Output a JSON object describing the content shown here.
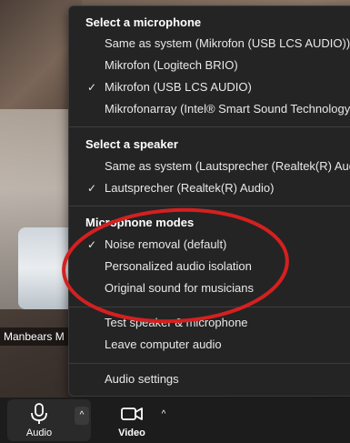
{
  "participant": {
    "name": "Manbears M"
  },
  "menu": {
    "microphone": {
      "title": "Select a microphone",
      "items": [
        {
          "label": "Same as system (Mikrofon (USB LCS AUDIO))",
          "checked": false
        },
        {
          "label": "Mikrofon (Logitech BRIO)",
          "checked": false
        },
        {
          "label": "Mikrofon (USB LCS AUDIO)",
          "checked": true
        },
        {
          "label": "Mikrofonarray (Intel® Smart Sound Technology",
          "checked": false
        }
      ]
    },
    "speaker": {
      "title": "Select a speaker",
      "items": [
        {
          "label": "Same as system (Lautsprecher (Realtek(R) Audio",
          "checked": false
        },
        {
          "label": "Lautsprecher (Realtek(R) Audio)",
          "checked": true
        }
      ]
    },
    "modes": {
      "title": "Microphone modes",
      "items": [
        {
          "label": "Noise removal (default)",
          "checked": true
        },
        {
          "label": "Personalized audio isolation",
          "checked": false
        },
        {
          "label": "Original sound for musicians",
          "checked": false
        }
      ]
    },
    "actions": {
      "test": "Test speaker & microphone",
      "leave": "Leave computer audio"
    },
    "settings": {
      "label": "Audio settings"
    },
    "check_glyph": "✓"
  },
  "toolbar": {
    "audio_label": "Audio",
    "video_label": "Video",
    "caret_glyph": "^",
    "audio_icon": "microphone-icon",
    "video_icon": "video-camera-icon"
  },
  "colors": {
    "menu_bg": "#242424",
    "annotation": "#d42020"
  }
}
